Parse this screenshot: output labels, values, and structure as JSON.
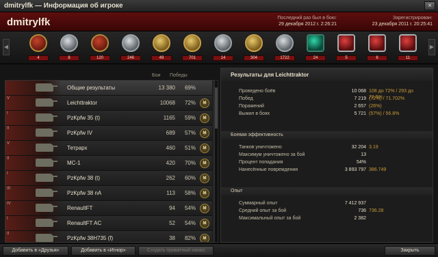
{
  "window": {
    "title": "dmitrylfk — Информация об игроке",
    "close": "×"
  },
  "header": {
    "player": "dmitrylfk",
    "last_battle_label": "Последний раз был в бою:",
    "last_battle": "29 декабря 2012 г. 2:26:21",
    "registered_label": "Зарегистрирован:",
    "registered": "23 декабря 2011 г. 20:25:41"
  },
  "medals": [
    {
      "icon": "tank-ace-medal-icon",
      "count": "4"
    },
    {
      "icon": "tank-class-medal-icon",
      "count": "8"
    },
    {
      "icon": "defender-medal-icon",
      "count": "120"
    },
    {
      "icon": "sniper-medal-icon",
      "count": "246"
    },
    {
      "icon": "warrior-medal-icon",
      "count": "49"
    },
    {
      "icon": "steel-wall-medal-icon",
      "count": "701"
    },
    {
      "icon": "invader-medal-icon",
      "count": "14"
    },
    {
      "icon": "scout-medal-icon",
      "count": "304"
    },
    {
      "icon": "patrol-duty-medal-icon",
      "count": "1722"
    },
    {
      "icon": "brothers-in-arms-icon",
      "count": "24"
    },
    {
      "icon": "crucial-contribution-icon",
      "count": "5"
    },
    {
      "icon": "sharpshooter-icon",
      "count": "6"
    },
    {
      "icon": "reaper-icon",
      "count": "11"
    }
  ],
  "table": {
    "col_battles": "Бои",
    "col_wins": "Победы",
    "rows": [
      {
        "tier": "",
        "name": "Общие результаты",
        "battles": "13 380",
        "wins": "69%",
        "mastery": ""
      },
      {
        "tier": "V",
        "name": "Leichttraktor",
        "battles": "10068",
        "wins": "72%",
        "mastery": "M"
      },
      {
        "tier": "I",
        "name": "PzKpfw 35 (t)",
        "battles": "1165",
        "wins": "59%",
        "mastery": "M"
      },
      {
        "tier": "II",
        "name": "PzKpfw IV",
        "battles": "689",
        "wins": "57%",
        "mastery": "M"
      },
      {
        "tier": "V",
        "name": "Тетрарх",
        "battles": "460",
        "wins": "51%",
        "mastery": "M"
      },
      {
        "tier": "II",
        "name": "МС-1",
        "battles": "420",
        "wins": "70%",
        "mastery": "M"
      },
      {
        "tier": "I",
        "name": "PzKpfw 38 (t)",
        "battles": "262",
        "wins": "60%",
        "mastery": "M"
      },
      {
        "tier": "III",
        "name": "PzKpfw 38 nA",
        "battles": "113",
        "wins": "58%",
        "mastery": "M"
      },
      {
        "tier": "IV",
        "name": "RenaultFT",
        "battles": "94",
        "wins": "54%",
        "mastery": "M"
      },
      {
        "tier": "I",
        "name": "RenaultFT AC",
        "battles": "52",
        "wins": "54%",
        "mastery": "M"
      },
      {
        "tier": "II",
        "name": "PzKpfw 38H735 (f)",
        "battles": "38",
        "wins": "82%",
        "mastery": "M"
      }
    ]
  },
  "details": {
    "title": "Результаты для Leichttraktor",
    "general": [
      {
        "label": "Проведено боёв",
        "value": "10 068",
        "extra": "108 до 72% / 293 до 72.5%"
      },
      {
        "label": "Побед",
        "value": "7 219",
        "extra": "(72%)  /  71.702%"
      },
      {
        "label": "Поражений",
        "value": "2 657",
        "extra": "(26%)"
      },
      {
        "label": "Выжил в боях",
        "value": "5 721",
        "extra": "(57%)  /  56.8%"
      }
    ],
    "eff_title": "Боевая эффективность",
    "eff": [
      {
        "label": "Танков уничтожено",
        "value": "32 204",
        "extra": "3.19"
      },
      {
        "label": "Максимум уничтожено за бой",
        "value": "13",
        "extra": ""
      },
      {
        "label": "Процент попадания",
        "value": "54%",
        "extra": ""
      },
      {
        "label": "Нанесённые повреждения",
        "value": "3 893 797",
        "extra": "386.749"
      }
    ],
    "exp_title": "Опыт",
    "exp": [
      {
        "label": "Суммарный опыт",
        "value": "7 412 937",
        "extra": ""
      },
      {
        "label": "Средний опыт за бой",
        "value": "736",
        "extra": "736.28"
      },
      {
        "label": "Максимальный опыт за бой",
        "value": "2 382",
        "extra": ""
      }
    ]
  },
  "footer": {
    "add_friends": "Добавить в «Друзья»",
    "add_ignore": "Добавить в «Игнор»",
    "private_channel": "Создать приватный канал",
    "close": "Закрыть"
  }
}
